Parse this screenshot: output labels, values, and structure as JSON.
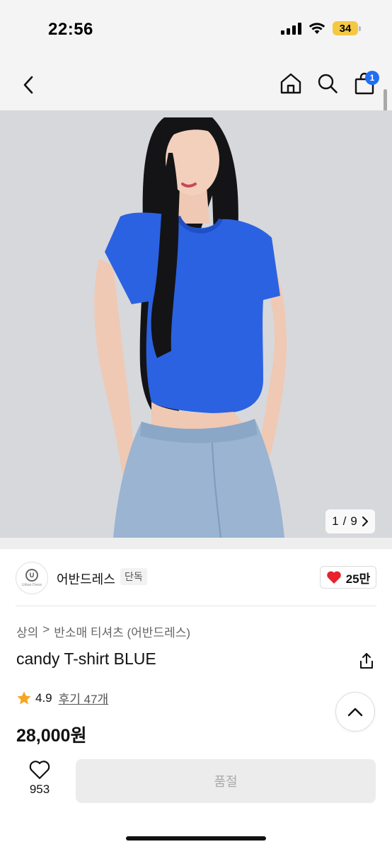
{
  "status_bar": {
    "time": "22:56",
    "battery": "34",
    "icons": [
      "signal-icon",
      "wifi-icon",
      "battery-icon"
    ]
  },
  "nav": {
    "back_icon": "chevron-left-icon",
    "home_icon": "home-icon",
    "search_icon": "search-icon",
    "cart_icon": "shopping-bag-icon",
    "cart_badge": "1"
  },
  "gallery": {
    "current": "1",
    "separator": "/",
    "total": "9",
    "next_icon": "chevron-right-icon"
  },
  "shop": {
    "name": "어반드레스",
    "tag": "단독",
    "logo_text": "Urban Dress",
    "likes": "25만"
  },
  "product": {
    "breadcrumb": [
      "상의",
      "반소매 티셔츠 (어반드레스)"
    ],
    "breadcrumb_separator": ">",
    "title": "candy T-shirt BLUE",
    "rating": "4.9",
    "review_label": "후기 47개",
    "price": "28,000원"
  },
  "actions": {
    "wish_count": "953",
    "soldout_label": "품절"
  },
  "colors": {
    "accent_blue": "#1f6ff5",
    "heart_red": "#e8212d",
    "star_orange": "#f5a623",
    "battery_yellow": "#f5c842"
  }
}
